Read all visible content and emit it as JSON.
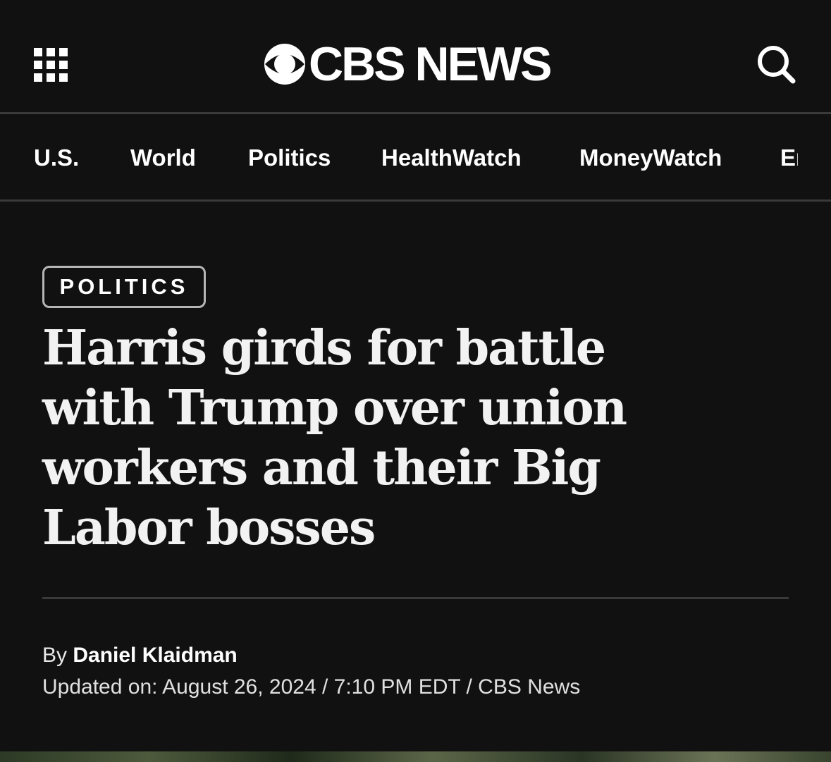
{
  "header": {
    "logo_text": "CBS NEWS",
    "menu_icon": "grid-menu-icon",
    "search_icon": "search-icon"
  },
  "nav": {
    "items": [
      "U.S.",
      "World",
      "Politics",
      "HealthWatch",
      "MoneyWatch",
      "Entertainment"
    ]
  },
  "article": {
    "category": "POLITICS",
    "headline": "Harris girds for battle with Trump over union workers and their Big Labor bosses",
    "byline_prefix": "By",
    "author": "Daniel Klaidman",
    "dateline": "Updated on: August 26, 2024 / 7:10 PM EDT / CBS News"
  },
  "colors": {
    "background": "#111111",
    "text": "#f2f2f2",
    "divider": "#3a3a3a",
    "tag_border": "#b5b5b5"
  }
}
